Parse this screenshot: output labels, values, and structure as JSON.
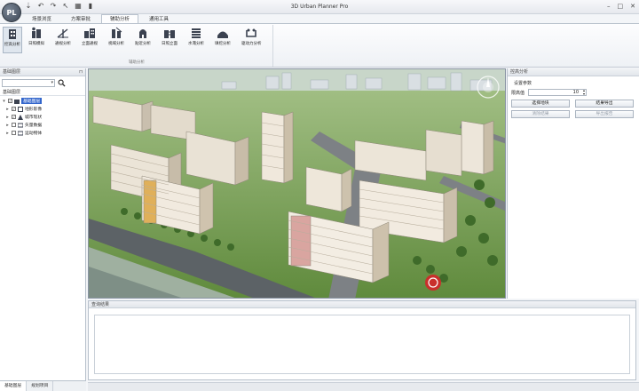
{
  "app": {
    "title": "3D Urban Planner Pro",
    "logo_text": "PL"
  },
  "ribbon": {
    "tabs": [
      {
        "label": "场景浏览"
      },
      {
        "label": "方案审批"
      },
      {
        "label": "辅助分析"
      },
      {
        "label": "通用工具"
      }
    ],
    "active_tab": "辅助分析",
    "group_label": "辅助分析",
    "buttons": [
      {
        "label": "控高分析",
        "icon": "height-control-icon"
      },
      {
        "label": "日照模拟",
        "icon": "sunlight-icon"
      },
      {
        "label": "通视分析",
        "icon": "sightline-icon"
      },
      {
        "label": "立面通视",
        "icon": "facade-icon"
      },
      {
        "label": "视域分析",
        "icon": "viewshed-icon"
      },
      {
        "label": "贴近分析",
        "icon": "proximity-icon"
      },
      {
        "label": "日照立面",
        "icon": "sun-facade-icon"
      },
      {
        "label": "水淹分析",
        "icon": "flood-icon"
      },
      {
        "label": "填挖分析",
        "icon": "cut-fill-icon"
      },
      {
        "label": "驱动力分析",
        "icon": "driving-force-icon"
      }
    ]
  },
  "left_panel": {
    "header": "基础图层",
    "tree_title": "基础图层",
    "tree": [
      {
        "label": "基础图层",
        "level": 0,
        "expanded": true,
        "checked": true
      },
      {
        "label": "地形影像",
        "level": 1,
        "checked": true
      },
      {
        "label": "城市现状",
        "level": 1,
        "checked": true
      },
      {
        "label": "矢量数据",
        "level": 1,
        "checked": false
      },
      {
        "label": "运动物体",
        "level": 1,
        "checked": false
      }
    ],
    "tabs": [
      {
        "label": "基础图层"
      },
      {
        "label": "规划项目"
      }
    ]
  },
  "right_panel": {
    "header": "控高分析",
    "section_label": "设置参数",
    "param_label": "限高值",
    "param_value": "10",
    "buttons": [
      {
        "label": "选择地块",
        "enabled": true
      },
      {
        "label": "结果导出",
        "enabled": true
      },
      {
        "label": "清除结果",
        "enabled": false
      },
      {
        "label": "导出报告",
        "enabled": false
      }
    ]
  },
  "bottom_panel": {
    "header": "查询结果"
  },
  "status": {
    "watermark": ""
  }
}
